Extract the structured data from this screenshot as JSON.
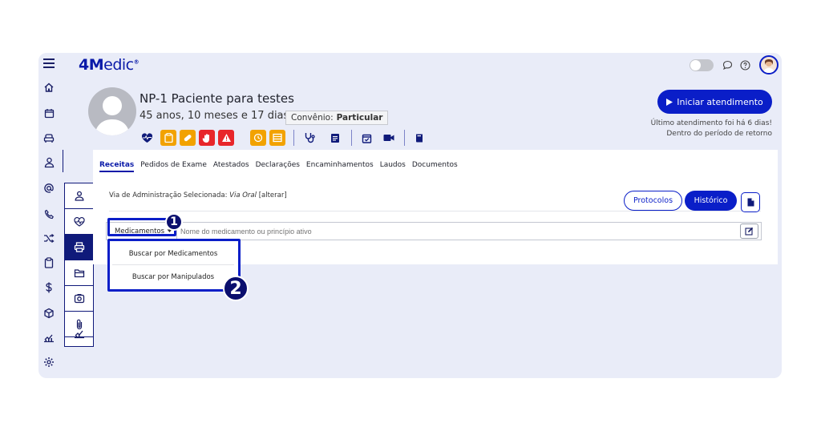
{
  "app": {
    "logo_bold": "4M",
    "logo_rest": "edic",
    "logo_mark": "®"
  },
  "patient": {
    "name": "NP-1 Paciente para testes",
    "age": "45 anos, 10 meses e 17 dias",
    "convenio_label": "Convênio:",
    "convenio_value": "Particular"
  },
  "header": {
    "start_button": "Iniciar atendimento",
    "last_attendance_line1": "Último atendimento foi há 6 dias!",
    "last_attendance_line2": "Dentro do período de retorno"
  },
  "toolbar_colors": [
    "#f2a200",
    "#f2a200",
    "#e8262b",
    "#e8262b",
    "#f2a200",
    "#f2a200"
  ],
  "tabs": [
    "Receitas",
    "Pedidos de Exame",
    "Atestados",
    "Declarações",
    "Encaminhamentos",
    "Laudos",
    "Documentos"
  ],
  "prescription": {
    "via_label": "Via de Administração Selecionada:",
    "via_value": "Via Oral",
    "via_change": "[alterar]",
    "protocols_button": "Protocolos",
    "history_button": "Histórico",
    "select_label": "Medicamentos",
    "search_placeholder": "Nome do medicamento ou princípio ativo"
  },
  "dropdown": {
    "items": [
      "Buscar por Medicamentos",
      "Buscar por Manipulados"
    ]
  },
  "callouts": {
    "one": "1",
    "two": "2"
  },
  "colors": {
    "brand": "#0a1ec8",
    "navy": "#0f1a7a",
    "background": "#e9ecf8"
  }
}
